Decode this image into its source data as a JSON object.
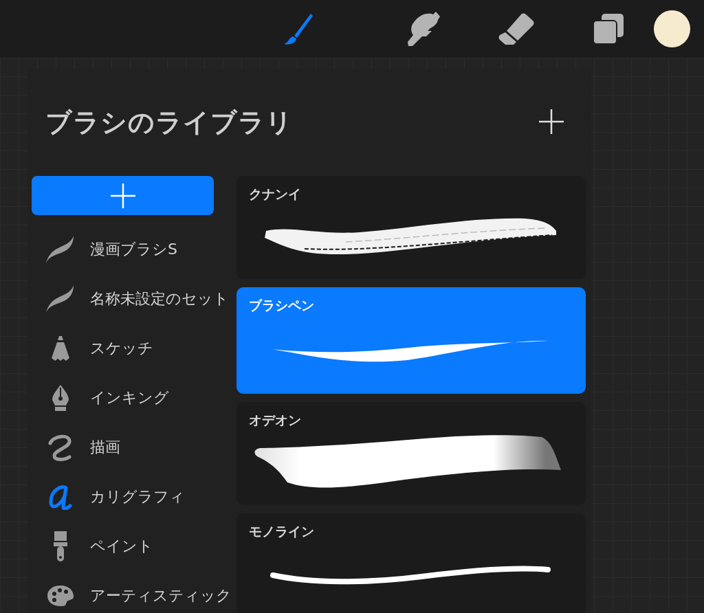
{
  "toolbar": {
    "tools": [
      {
        "kind": "brush",
        "selected": true
      },
      {
        "kind": "smudge",
        "selected": false
      },
      {
        "kind": "eraser",
        "selected": false
      },
      {
        "kind": "layers",
        "selected": false
      }
    ],
    "color": "#f7ebcf"
  },
  "panel": {
    "title": "ブラシのライブラリ",
    "categories": [
      {
        "kind": "stroke",
        "label": "漫画ブラシS"
      },
      {
        "kind": "stroke",
        "label": "名称未設定のセット"
      },
      {
        "kind": "pencil",
        "label": "スケッチ"
      },
      {
        "kind": "nib",
        "label": "インキング"
      },
      {
        "kind": "squiggle",
        "label": "描画"
      },
      {
        "kind": "letter",
        "label": "カリグラフィ"
      },
      {
        "kind": "paintbrush",
        "label": "ペイント"
      },
      {
        "kind": "palette",
        "label": "アーティスティック"
      }
    ],
    "brushes": [
      {
        "kind": "rough",
        "name": "クナンイ",
        "selected": false
      },
      {
        "kind": "taper",
        "name": "ブラシペン",
        "selected": true
      },
      {
        "kind": "ribbon",
        "name": "オデオン",
        "selected": false
      },
      {
        "kind": "mono",
        "name": "モノライン",
        "selected": false
      }
    ]
  }
}
